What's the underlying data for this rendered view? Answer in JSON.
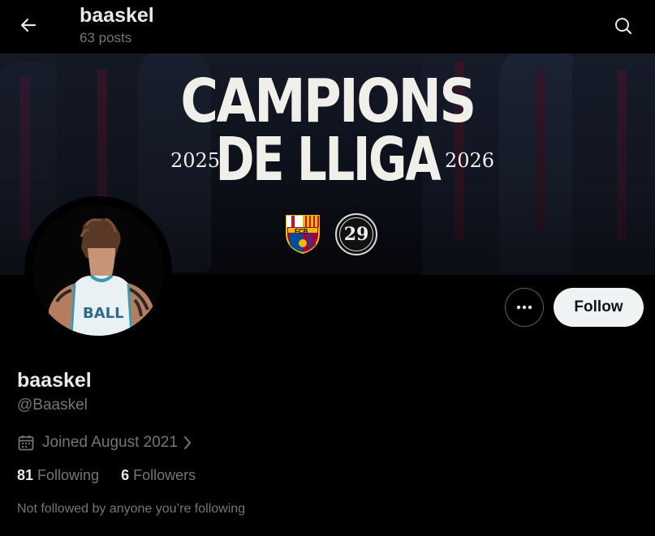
{
  "header": {
    "title": "baaskel",
    "posts_count": "63 posts",
    "back_icon": "arrow-left-icon",
    "search_icon": "search-icon"
  },
  "banner": {
    "headline_line1": "CAMPIONS",
    "headline_line2": "DE LLIGA",
    "year_left": "2025",
    "year_right": "2026",
    "badge_number": "29",
    "crest_letters": "FCB"
  },
  "profile": {
    "display_name": "baaskel",
    "handle": "@Baaskel",
    "joined": "Joined August 2021",
    "following_count": "81",
    "following_label": "Following",
    "followers_count": "6",
    "followers_label": "Followers",
    "note": "Not followed by anyone you’re following",
    "avatar_jersey_text": "BALL"
  },
  "actions": {
    "more_icon": "more-dots-icon",
    "follow_label": "Follow"
  },
  "colors": {
    "background": "#000000",
    "primary_text": "#e7e9ea",
    "secondary_text": "#71767b",
    "follow_button_bg": "#eff3f4",
    "follow_button_text": "#0f1419"
  }
}
